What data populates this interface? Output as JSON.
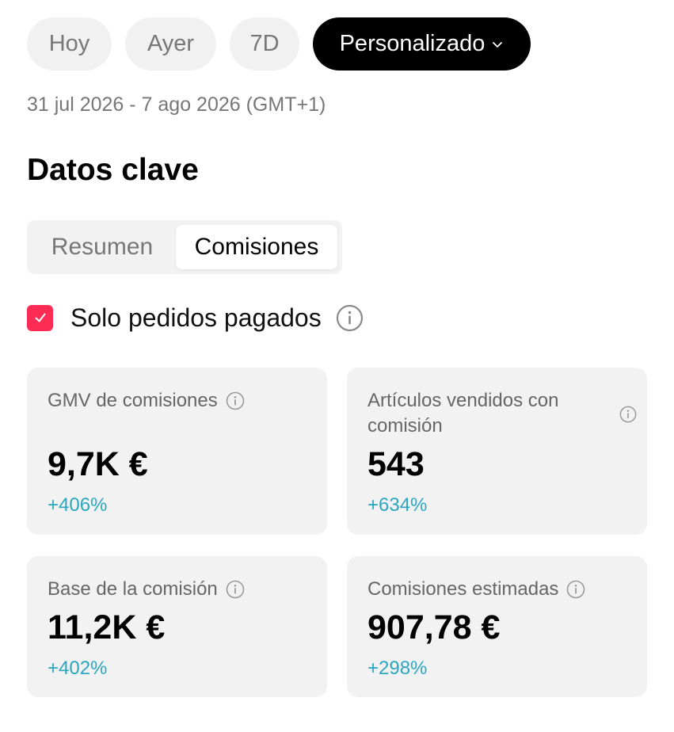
{
  "date_filters": {
    "hoy": "Hoy",
    "ayer": "Ayer",
    "d7": "7D",
    "custom": "Personalizado",
    "selected": "Personalizado"
  },
  "date_range": "31 jul 2026 - 7 ago 2026 (GMT+1)",
  "section_title": "Datos clave",
  "tabs": {
    "resumen": "Resumen",
    "comisiones": "Comisiones",
    "active": "Comisiones"
  },
  "filter": {
    "label": "Solo pedidos pagados",
    "checked": true
  },
  "metrics": [
    {
      "label": "GMV de comisiones",
      "value": "9,7K €",
      "change": "+406%"
    },
    {
      "label": "Artículos vendidos con comisión",
      "value": "543",
      "change": "+634%"
    },
    {
      "label": "Base de la comisión",
      "value": "11,2K €",
      "change": "+402%"
    },
    {
      "label": "Comisiones estimadas",
      "value": "907,78 €",
      "change": "+298%"
    }
  ],
  "colors": {
    "accent_checkbox": "#fe2c55",
    "positive_change": "#2aa6c1",
    "selected_pill": "#000000",
    "card_background": "#f2f2f2"
  },
  "icons": {
    "info": "info-circle-icon",
    "chevron": "chevron-down-icon",
    "check": "check-icon"
  }
}
